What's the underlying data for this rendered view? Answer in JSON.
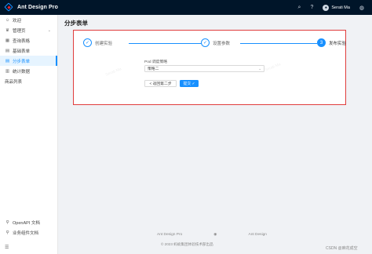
{
  "header": {
    "app_title": "Ant Design Pro",
    "username": "Serati Ma",
    "icons": [
      "search-icon",
      "question-icon",
      "globe-icon"
    ]
  },
  "sidebar": {
    "items": [
      {
        "label": "欢迎",
        "icon": "smile-icon"
      },
      {
        "label": "管理页",
        "icon": "crown-icon",
        "has_submenu": true
      },
      {
        "label": "查询表格",
        "icon": "table-icon"
      },
      {
        "label": "基础表单",
        "icon": "form-icon"
      },
      {
        "label": "分步表单",
        "icon": "form-icon",
        "active": true
      },
      {
        "label": "统计数据",
        "icon": "chart-icon"
      },
      {
        "label": "商品列表",
        "icon": ""
      }
    ],
    "bottom_items": [
      {
        "label": "OpenAPI 文档",
        "icon": "link-icon"
      },
      {
        "label": "业务组件文档",
        "icon": "link-icon"
      }
    ]
  },
  "page": {
    "title": "分步表单"
  },
  "steps": [
    {
      "title": "创建实验",
      "status": "finish",
      "mark": "✓"
    },
    {
      "title": "设置参数",
      "status": "finish",
      "mark": "✓"
    },
    {
      "title": "发布实验",
      "status": "process",
      "mark": "3"
    }
  ],
  "form": {
    "field_label": "Pod 调度策略",
    "select_value": "策略二",
    "prev_label": "< 返回第二步",
    "submit_label": "提交 ✓"
  },
  "watermark": "Serati Ma",
  "footer": {
    "links": [
      "Ant Design Pro",
      "github-icon",
      "Ant Design"
    ],
    "copyright": "© 2023 蚂蚁集团体验技术部出品"
  },
  "csdn_mark": "CSDN @麻花成空"
}
